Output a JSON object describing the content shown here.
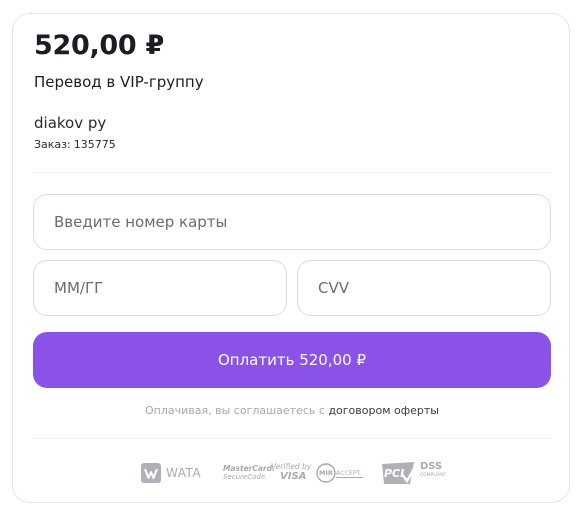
{
  "payment": {
    "amount": "520,00 ₽",
    "purpose": "Перевод в VIP-группу",
    "merchant": "diakov py",
    "order_label": "Заказ:",
    "order_number": "135775"
  },
  "form": {
    "card_number_placeholder": "Введите номер карты",
    "expiry_placeholder": "ММ/ГГ",
    "cvv_placeholder": "CVV",
    "pay_button_label": "Оплатить 520,00 ₽"
  },
  "terms": {
    "prefix": "Оплачивая, вы соглашаетесь с",
    "link_text": "договором оферты"
  },
  "footer_logos": {
    "wata": "WATA",
    "mastercard_line1": "MasterCard.",
    "mastercard_line2": "SecureCode.",
    "visa_line1": "Verified by",
    "visa_line2": "VISA",
    "mir_brand": "MIR",
    "mir_suffix": "ACCEPT",
    "pci": "PCI",
    "dss": "DSS",
    "dss_sub": "COMPLIANT"
  },
  "colors": {
    "accent": "#8a52e6",
    "text": "#1c1c22",
    "muted": "#a7a7b0",
    "border": "#dcdce2"
  }
}
